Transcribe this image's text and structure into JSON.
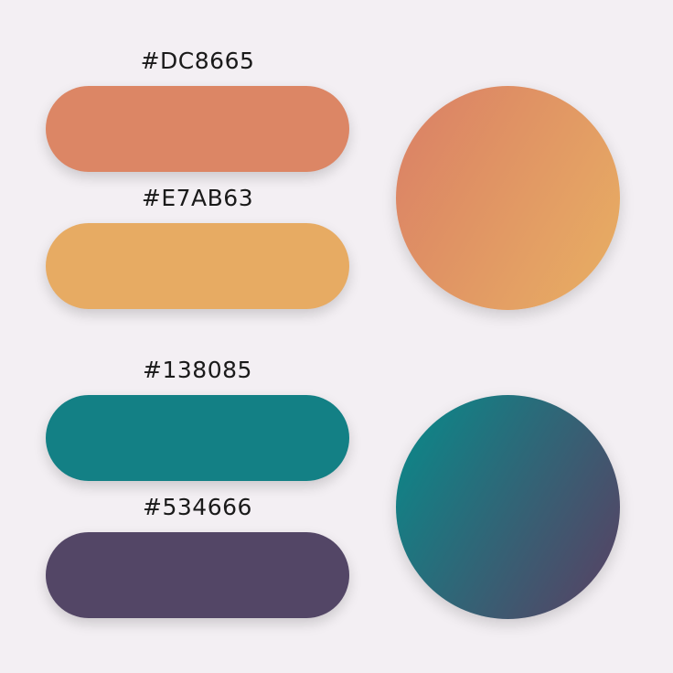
{
  "palette": {
    "warm": {
      "swatches": [
        {
          "label": "#DC8665",
          "color": "#DC8665"
        },
        {
          "label": "#E7AB63",
          "color": "#E7AB63"
        }
      ],
      "gradient": {
        "from": "#DC8665",
        "to": "#E7AB63"
      }
    },
    "cool": {
      "swatches": [
        {
          "label": "#138085",
          "color": "#138085"
        },
        {
          "label": "#534666",
          "color": "#534666"
        }
      ],
      "gradient": {
        "from": "#138085",
        "to": "#534666"
      }
    }
  }
}
